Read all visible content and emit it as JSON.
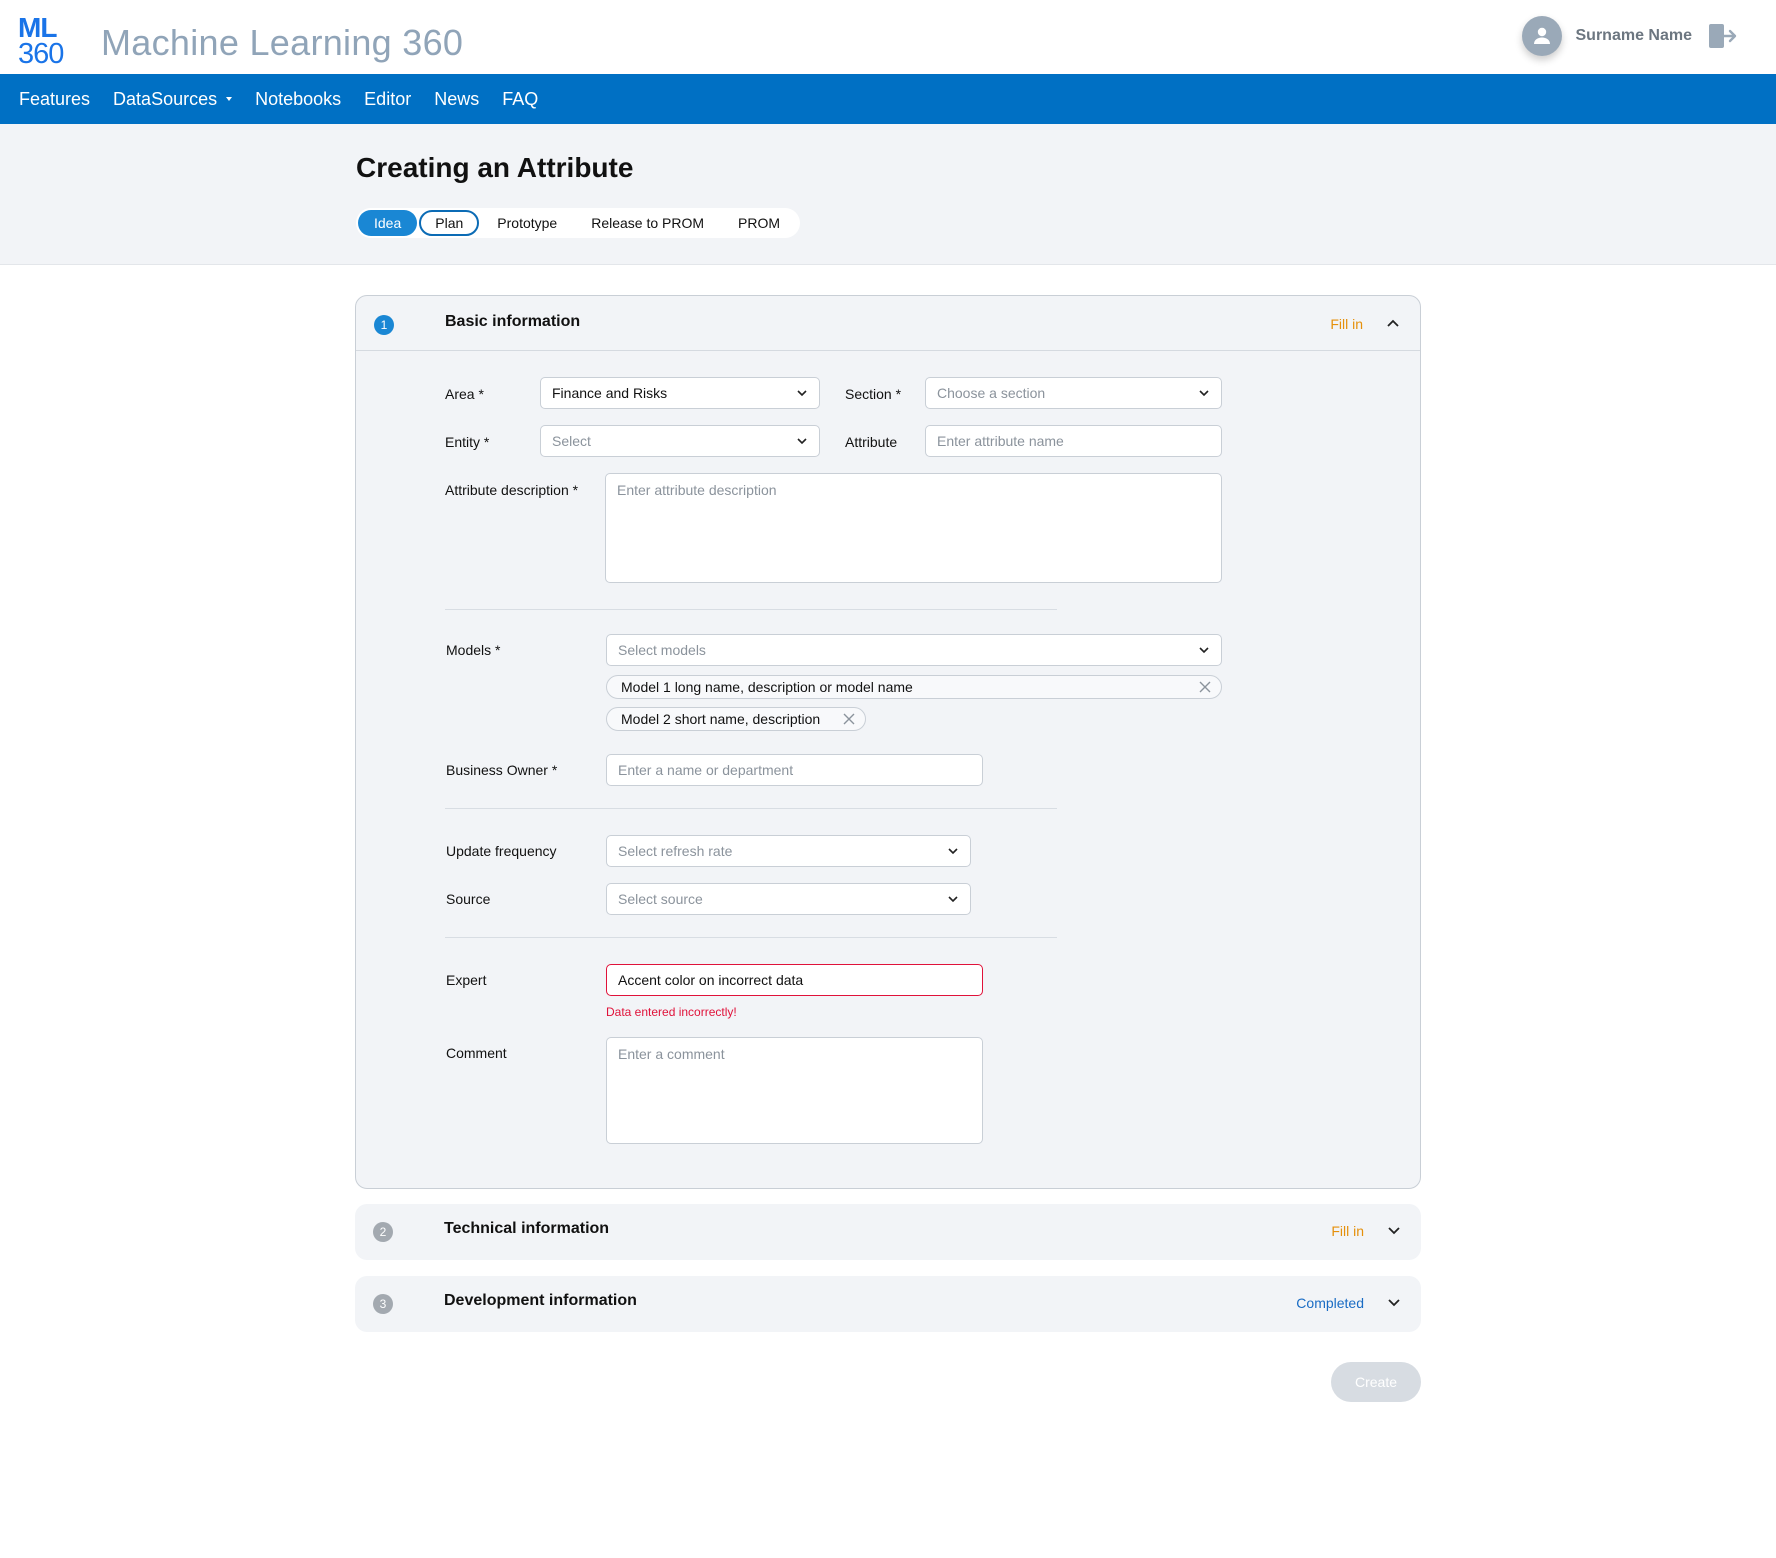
{
  "header": {
    "logo_line1": "ML",
    "logo_line2": "360",
    "app_title": "Machine Learning 360",
    "user_name": "Surname Name"
  },
  "nav": {
    "items": [
      {
        "label": "Features"
      },
      {
        "label": "DataSources",
        "has_dropdown": true
      },
      {
        "label": "Notebooks"
      },
      {
        "label": "Editor"
      },
      {
        "label": "News"
      },
      {
        "label": "FAQ"
      }
    ]
  },
  "page": {
    "title": "Creating an Attribute",
    "stages": [
      "Idea",
      "Plan",
      "Prototype",
      "Release to PROM",
      "PROM"
    ]
  },
  "sections": [
    {
      "num": "1",
      "title": "Basic information",
      "status": "Fill in"
    },
    {
      "num": "2",
      "title": "Technical information",
      "status": "Fill in"
    },
    {
      "num": "3",
      "title": "Development information",
      "status": "Completed"
    }
  ],
  "form": {
    "area_label": "Area *",
    "area_value": "Finance and Risks",
    "section_label": "Section *",
    "section_placeholder": "Choose a section",
    "entity_label": "Entity *",
    "entity_placeholder": "Select",
    "attribute_label": "Attribute",
    "attribute_placeholder": "Enter attribute name",
    "description_label": "Attribute description *",
    "description_placeholder": "Enter attribute description",
    "models_label": "Models *",
    "models_placeholder": "Select models",
    "model_chips": [
      "Model 1 long name, description or model name",
      "Model 2 short name, description"
    ],
    "owner_label": "Business Owner *",
    "owner_placeholder": "Enter a name or department",
    "frequency_label": "Update frequency",
    "frequency_placeholder": "Select refresh rate",
    "source_label": "Source",
    "source_placeholder": "Select source",
    "expert_label": "Expert",
    "expert_value": "Accent color on incorrect data",
    "expert_error": "Data entered incorrectly!",
    "comment_label": "Comment",
    "comment_placeholder": "Enter a comment"
  },
  "actions": {
    "create_label": "Create"
  },
  "colors": {
    "brand_blue": "#0070c4",
    "accent": "#1a87d4",
    "warning": "#e5900b",
    "error": "#e0123a",
    "completed": "#1a6cc4"
  }
}
